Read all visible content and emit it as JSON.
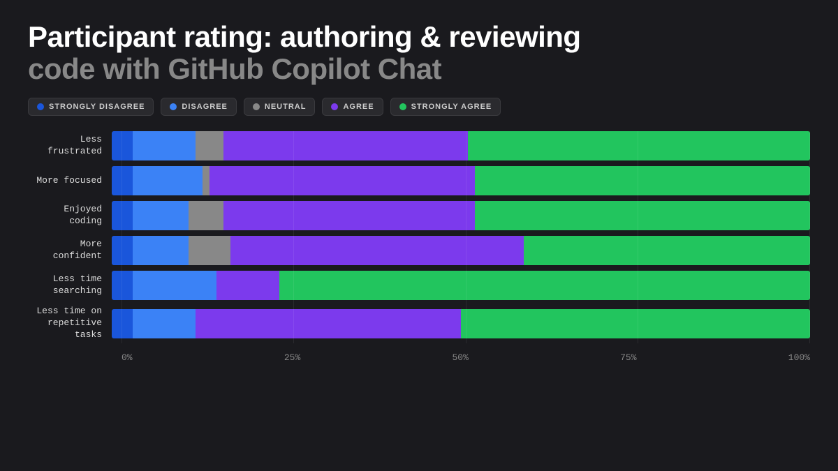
{
  "title": {
    "line1": "Participant rating: authoring & reviewing",
    "line2": "code with GitHub Copilot Chat"
  },
  "legend": [
    {
      "id": "strongly-disagree",
      "label": "STRONGLY DISAGREE",
      "color": "#1a56db"
    },
    {
      "id": "disagree",
      "label": "DISAGREE",
      "color": "#3b82f6"
    },
    {
      "id": "neutral",
      "label": "Neutral",
      "color": "#888888"
    },
    {
      "id": "agree",
      "label": "AGREE",
      "color": "#7c3aed"
    },
    {
      "id": "strongly-agree",
      "label": "STRONGLY AGREE",
      "color": "#22c55e"
    }
  ],
  "rows": [
    {
      "label": "Less frustrated",
      "segments": [
        {
          "type": "strongly-disagree",
          "pct": 3,
          "color": "#1a56db"
        },
        {
          "type": "disagree",
          "pct": 9,
          "color": "#3b82f6"
        },
        {
          "type": "neutral",
          "pct": 4,
          "color": "#888888"
        },
        {
          "type": "agree",
          "pct": 35,
          "color": "#7c3aed"
        },
        {
          "type": "strongly-agree",
          "pct": 49,
          "color": "#22c55e"
        }
      ]
    },
    {
      "label": "More focused",
      "segments": [
        {
          "type": "strongly-disagree",
          "pct": 3,
          "color": "#1a56db"
        },
        {
          "type": "disagree",
          "pct": 10,
          "color": "#3b82f6"
        },
        {
          "type": "neutral",
          "pct": 1,
          "color": "#888888"
        },
        {
          "type": "agree",
          "pct": 38,
          "color": "#7c3aed"
        },
        {
          "type": "strongly-agree",
          "pct": 48,
          "color": "#22c55e"
        }
      ]
    },
    {
      "label": "Enjoyed coding",
      "segments": [
        {
          "type": "strongly-disagree",
          "pct": 3,
          "color": "#1a56db"
        },
        {
          "type": "disagree",
          "pct": 8,
          "color": "#3b82f6"
        },
        {
          "type": "neutral",
          "pct": 5,
          "color": "#888888"
        },
        {
          "type": "agree",
          "pct": 36,
          "color": "#7c3aed"
        },
        {
          "type": "strongly-agree",
          "pct": 48,
          "color": "#22c55e"
        }
      ]
    },
    {
      "label": "More confident",
      "segments": [
        {
          "type": "strongly-disagree",
          "pct": 3,
          "color": "#1a56db"
        },
        {
          "type": "disagree",
          "pct": 8,
          "color": "#3b82f6"
        },
        {
          "type": "neutral",
          "pct": 6,
          "color": "#888888"
        },
        {
          "type": "agree",
          "pct": 42,
          "color": "#7c3aed"
        },
        {
          "type": "strongly-agree",
          "pct": 41,
          "color": "#22c55e"
        }
      ]
    },
    {
      "label": "Less time\nsearching",
      "segments": [
        {
          "type": "strongly-disagree",
          "pct": 3,
          "color": "#1a56db"
        },
        {
          "type": "disagree",
          "pct": 12,
          "color": "#3b82f6"
        },
        {
          "type": "neutral",
          "pct": 0,
          "color": "#888888"
        },
        {
          "type": "agree",
          "pct": 9,
          "color": "#7c3aed"
        },
        {
          "type": "strongly-agree",
          "pct": 76,
          "color": "#22c55e"
        }
      ]
    },
    {
      "label": "Less time on\nrepetitive tasks",
      "segments": [
        {
          "type": "strongly-disagree",
          "pct": 3,
          "color": "#1a56db"
        },
        {
          "type": "disagree",
          "pct": 9,
          "color": "#3b82f6"
        },
        {
          "type": "neutral",
          "pct": 0,
          "color": "#888888"
        },
        {
          "type": "agree",
          "pct": 38,
          "color": "#7c3aed"
        },
        {
          "type": "strongly-agree",
          "pct": 50,
          "color": "#22c55e"
        }
      ]
    }
  ],
  "xaxis": {
    "labels": [
      "0%",
      "25%",
      "50%",
      "75%",
      "100%"
    ]
  }
}
